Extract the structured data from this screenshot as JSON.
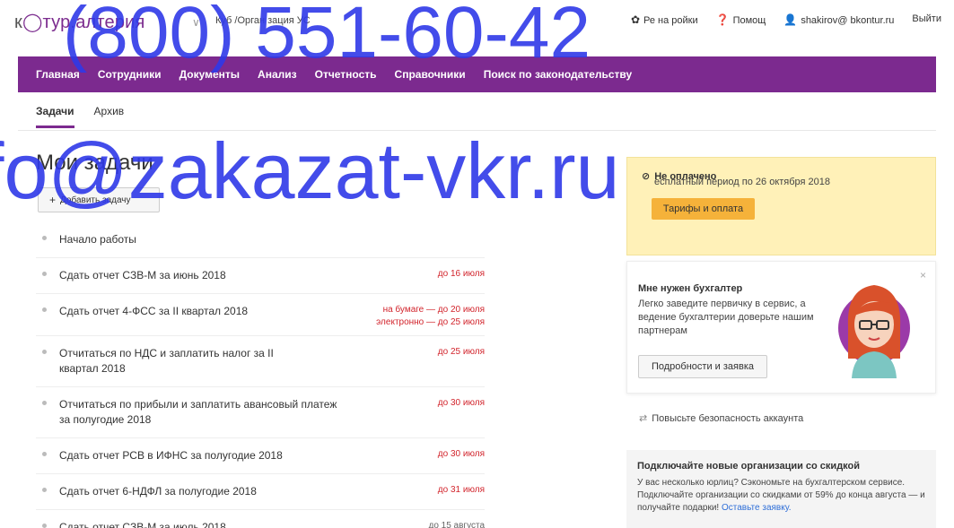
{
  "topbar": {
    "logo_prefix": "к",
    "logo_main": "тур.",
    "logo_accent": "",
    "logo_tail": "алтерия",
    "org": "Куб    /Орган   зация УС",
    "settings": "Ре          на   ройки",
    "help": "Помощ",
    "user": "shakirov@    bkontur.ru",
    "logout": "Выйти"
  },
  "nav": {
    "items": [
      "Главная",
      "Сотрудники",
      "Документы",
      "Анализ",
      "Отчетность",
      "Справочники",
      "Поиск по законодательству"
    ]
  },
  "subtabs": {
    "tasks": "Задачи",
    "archive": "Архив"
  },
  "main": {
    "title": "Мои задачи",
    "add_button": "Добавить задачу",
    "tasks": [
      {
        "name": "Начало работы",
        "due": ""
      },
      {
        "name": "Сдать отчет СЗВ-М за июнь 2018",
        "due": "до 16 июля"
      },
      {
        "name": "Сдать отчет 4-ФСС за II квартал 2018",
        "due": "на бумаге — до 20 июля\nэлектронно — до 25 июля"
      },
      {
        "name": "Отчитаться по НДС и заплатить налог за II квартал 2018",
        "due": "до 25 июля"
      },
      {
        "name": "Отчитаться по прибыли и заплатить авансовый платеж за полугодие 2018",
        "due": "до 30 июля"
      },
      {
        "name": "Сдать отчет РСВ в ИФНС за полугодие 2018",
        "due": "до 30 июля"
      },
      {
        "name": "Сдать отчет 6-НДФЛ за полугодие 2018",
        "due": "до 31 июля"
      },
      {
        "name": "Сдать отчет СЗВ-М за июль 2018",
        "due": "до 15 августа"
      }
    ]
  },
  "notice": {
    "heading": "Не оплачено",
    "text": "есплатный период по 26 октября 2018",
    "pay_button": "Тарифы и оплата"
  },
  "promo": {
    "title": "Мне нужен бухгалтер",
    "desc": "Легко заведите первичку в сервис, а ведение бухгалтерии доверьте нашим партнерам",
    "button": "Подробности и заявка",
    "close": "×"
  },
  "security": {
    "text": "Повысьте безопасность аккаунта"
  },
  "discount": {
    "title": "Подключайте новые организации со скидкой",
    "desc": "У вас несколько юрлиц? Сэкономьте на бухгалтерском сервисе. Подключайте организации со скидками от 59% до конца августа — и получайте подарки! ",
    "link": "Оставьте заявку."
  },
  "watermark": {
    "phone": "(800) 551-60-42",
    "email": "fo@zakazat-vkr.ru"
  },
  "colors": {
    "brand_purple": "#7c2a8f",
    "deadline_red": "#d2242c",
    "notice_yellow": "#fff1b8",
    "pay_orange": "#f5b23a",
    "watermark_blue": "#2f39e8"
  }
}
